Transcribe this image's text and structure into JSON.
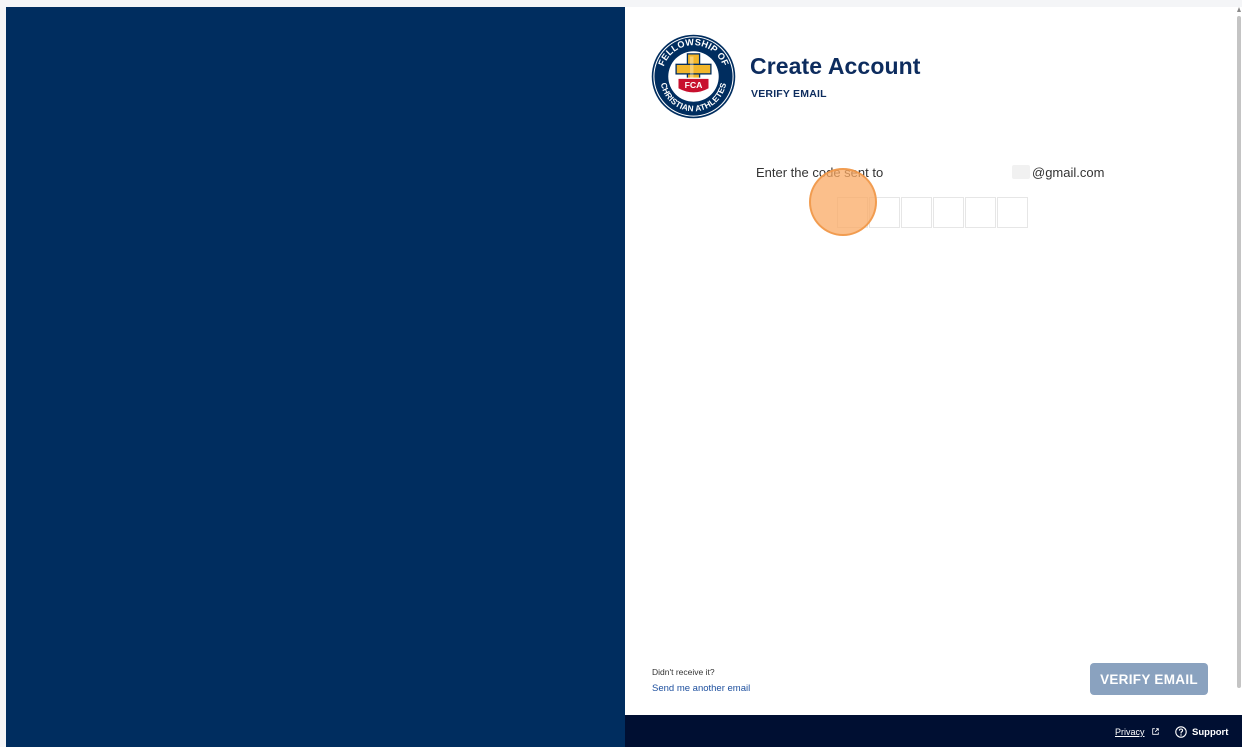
{
  "brand": {
    "logo_icon": "fca-logo-icon",
    "logo_text": "FELLOWSHIP OF CHRISTIAN ATHLETES",
    "logo_badge": "FCA",
    "colors": {
      "navy": "#002d5f",
      "footer": "#000f32",
      "title": "#0d2c5e",
      "gold": "#f2b62a",
      "red": "#c8102e",
      "button_disabled": "#8aa2bf",
      "link": "#1d4f9e"
    }
  },
  "header": {
    "title": "Create Account",
    "subtitle": "VERIFY EMAIL"
  },
  "verify": {
    "prompt": "Enter the code sent to",
    "email_domain": "@gmail.com",
    "code_digits": [
      "",
      "",
      "",
      "",
      "",
      ""
    ]
  },
  "resend": {
    "question": "Didn't receive it?",
    "link": "Send me another email"
  },
  "actions": {
    "verify_label": "VERIFY EMAIL"
  },
  "footer": {
    "privacy_label": "Privacy",
    "privacy_icon": "external-link-icon",
    "support_label": "Support",
    "support_icon": "help-circle-icon"
  }
}
